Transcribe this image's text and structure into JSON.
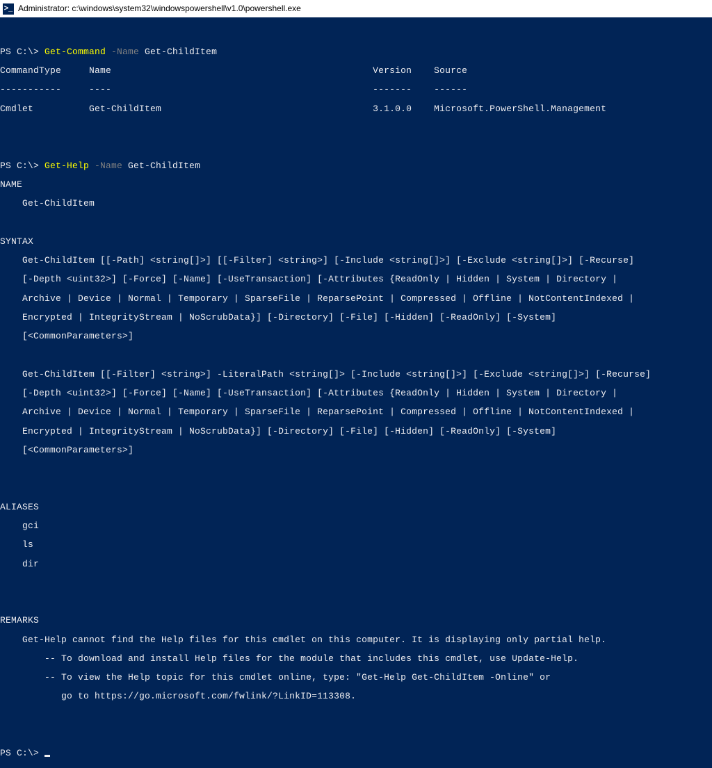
{
  "titlebar": {
    "icon_glyph": ">_",
    "title": "Administrator: c:\\windows\\system32\\windowspowershell\\v1.0\\powershell.exe"
  },
  "cmd1": {
    "prompt": "PS C:\\> ",
    "cmdlet": "Get-Command",
    "param_flag": " -Name",
    "arg": " Get-ChildItem"
  },
  "table": {
    "header": "CommandType     Name                                               Version    Source",
    "divider": "-----------     ----                                               -------    ------",
    "row": "Cmdlet          Get-ChildItem                                      3.1.0.0    Microsoft.PowerShell.Management"
  },
  "cmd2": {
    "prompt": "PS C:\\> ",
    "cmdlet": "Get-Help",
    "param_flag": " -Name",
    "arg": " Get-ChildItem"
  },
  "help": {
    "l_name_hdr": "NAME",
    "l_name_val": "    Get-ChildItem",
    "l_syntax_hdr": "SYNTAX",
    "s1_l1": "    Get-ChildItem [[-Path] <string[]>] [[-Filter] <string>] [-Include <string[]>] [-Exclude <string[]>] [-Recurse]",
    "s1_l2": "    [-Depth <uint32>] [-Force] [-Name] [-UseTransaction] [-Attributes {ReadOnly | Hidden | System | Directory |",
    "s1_l3": "    Archive | Device | Normal | Temporary | SparseFile | ReparsePoint | Compressed | Offline | NotContentIndexed |",
    "s1_l4": "    Encrypted | IntegrityStream | NoScrubData}] [-Directory] [-File] [-Hidden] [-ReadOnly] [-System]",
    "s1_l5": "    [<CommonParameters>]",
    "s2_l1": "    Get-ChildItem [[-Filter] <string>] -LiteralPath <string[]> [-Include <string[]>] [-Exclude <string[]>] [-Recurse]",
    "s2_l2": "    [-Depth <uint32>] [-Force] [-Name] [-UseTransaction] [-Attributes {ReadOnly | Hidden | System | Directory |",
    "s2_l3": "    Archive | Device | Normal | Temporary | SparseFile | ReparsePoint | Compressed | Offline | NotContentIndexed |",
    "s2_l4": "    Encrypted | IntegrityStream | NoScrubData}] [-Directory] [-File] [-Hidden] [-ReadOnly] [-System]",
    "s2_l5": "    [<CommonParameters>]",
    "l_aliases_hdr": "ALIASES",
    "l_alias1": "    gci",
    "l_alias2": "    ls",
    "l_alias3": "    dir",
    "l_remarks_hdr": "REMARKS",
    "r_l1": "    Get-Help cannot find the Help files for this cmdlet on this computer. It is displaying only partial help.",
    "r_l2": "        -- To download and install Help files for the module that includes this cmdlet, use Update-Help.",
    "r_l3": "        -- To view the Help topic for this cmdlet online, type: \"Get-Help Get-ChildItem -Online\" or",
    "r_l4": "           go to https://go.microsoft.com/fwlink/?LinkID=113308."
  },
  "cmd3": {
    "prompt": "PS C:\\> "
  }
}
